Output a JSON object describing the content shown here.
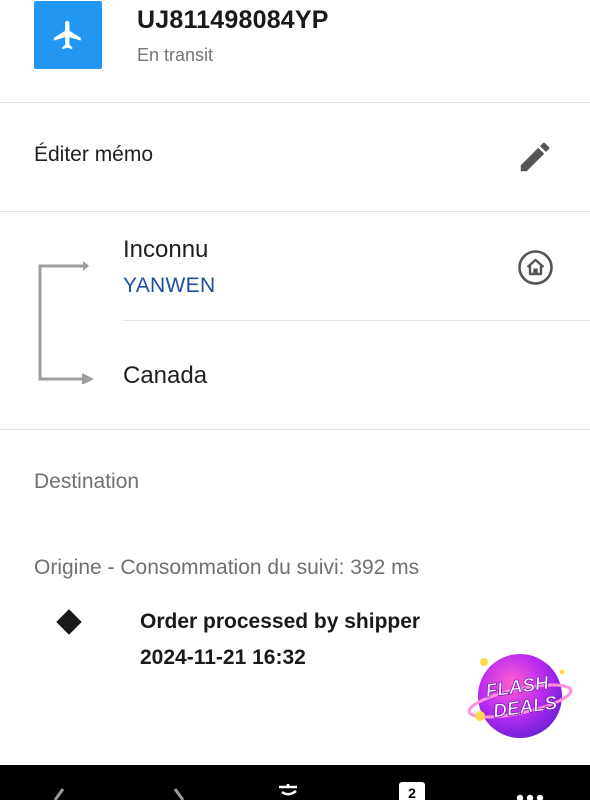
{
  "shipment": {
    "tracking_number": "UJ811498084YP",
    "status": "En transit",
    "status_icon": "airplane-icon",
    "accent_color": "#2196f3"
  },
  "memo": {
    "label": "Éditer mémo",
    "icon": "pencil-icon"
  },
  "route": {
    "origin": "Inconnu",
    "carrier": "YANWEN",
    "carrier_color": "#1f4fa3",
    "destination": "Canada",
    "home_icon": "home-circle-icon"
  },
  "sections": {
    "destination_label": "Destination",
    "origin_label": "Origine - Consommation du suivi: 392 ms"
  },
  "events": [
    {
      "description": "Order processed by shipper",
      "datetime": "2024-11-21 16:32"
    }
  ],
  "promo": {
    "line1": "FLASH",
    "line2": "DEALS"
  },
  "bottom_bar": {
    "buttons": [
      "back-icon",
      "forward-icon",
      "translate-icon",
      "tabs-icon",
      "more-icon"
    ],
    "tab_count": "2"
  }
}
